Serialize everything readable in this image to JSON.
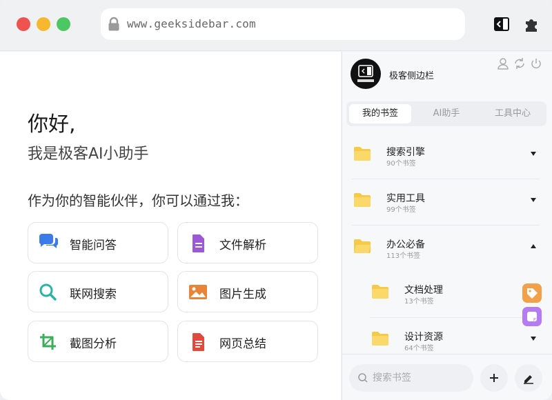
{
  "browser": {
    "url": "www.geeksidebar.com"
  },
  "main": {
    "greeting": "你好,",
    "subtitle": "我是极客AI小助手",
    "intro": "作为你的智能伙伴，你可以通过我：",
    "features": [
      {
        "label": "智能问答",
        "icon": "chat-bubbles-icon",
        "color": "#3b7bea"
      },
      {
        "label": "文件解析",
        "icon": "document-icon",
        "color": "#9b59d6"
      },
      {
        "label": "联网搜索",
        "icon": "search-icon",
        "color": "#2bb5a0"
      },
      {
        "label": "图片生成",
        "icon": "image-icon",
        "color": "#e8843a"
      },
      {
        "label": "截图分析",
        "icon": "crop-icon",
        "color": "#3cae5a"
      },
      {
        "label": "网页总结",
        "icon": "webpage-doc-icon",
        "color": "#e04a3c"
      }
    ]
  },
  "sidebar": {
    "brand_name": "极客侧边栏",
    "tabs": [
      {
        "label": "我的书签"
      },
      {
        "label": "AI助手"
      },
      {
        "label": "工具中心"
      }
    ],
    "folders": [
      {
        "name": "搜索引擎",
        "count": "90个书签",
        "expanded": false
      },
      {
        "name": "实用工具",
        "count": "99个书签",
        "expanded": false
      },
      {
        "name": "办公必备",
        "count": "113个书签",
        "expanded": true
      },
      {
        "name": "文档处理",
        "count": "13个书签",
        "expanded": false,
        "nested": true
      },
      {
        "name": "设计资源",
        "count": "64个书签",
        "expanded": false,
        "nested": true
      }
    ],
    "search_placeholder": "搜索书签"
  },
  "colors": {
    "folder": "#f7c948",
    "accent_orange": "#f2a14a",
    "accent_purple": "#b57bf0"
  }
}
